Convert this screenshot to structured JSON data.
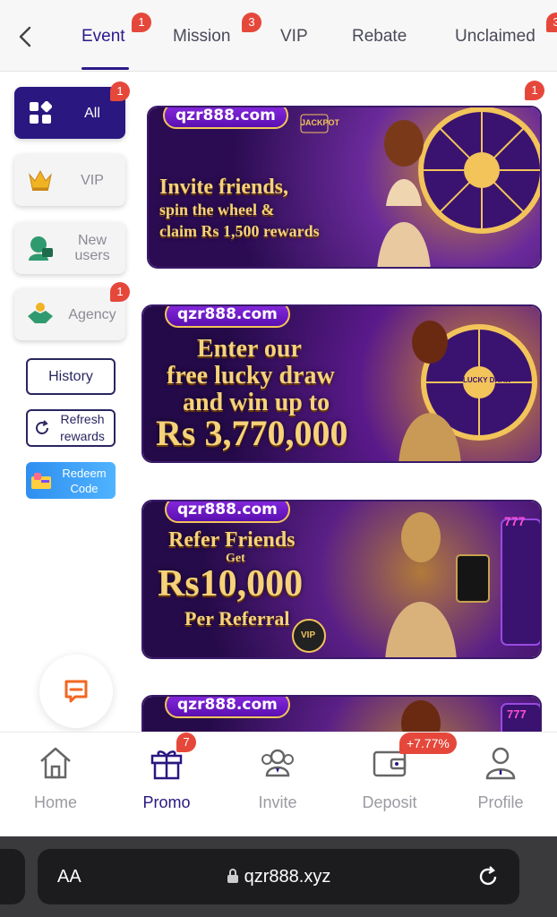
{
  "tabs": [
    {
      "label": "Event",
      "badge": "1"
    },
    {
      "label": "Mission",
      "badge": "3"
    },
    {
      "label": "VIP",
      "badge": ""
    },
    {
      "label": "Rebate",
      "badge": ""
    },
    {
      "label": "Unclaimed",
      "badge": "3"
    }
  ],
  "sidebar": {
    "all_label": "All",
    "all_badge": "1",
    "vip_label": "VIP",
    "new_users_label": "New users",
    "agency_label": "Agency",
    "agency_badge": "1",
    "history_label": "History",
    "refresh_label": "Refresh rewards",
    "redeem_label": "Redeem Code"
  },
  "banners": [
    {
      "domain": "qzr888.com",
      "line1": "Invite friends,",
      "line2": "spin the wheel &",
      "line3": "claim Rs 1,500 rewards",
      "sign": "JACKPOT",
      "badge": "1"
    },
    {
      "domain": "qzr888.com",
      "line1": "Enter our",
      "line2": "free lucky draw",
      "line3": "and win up to",
      "line4": "Rs 3,770,000",
      "wheel": "LUCKY DRAW"
    },
    {
      "domain": "qzr888.com",
      "line1": "Refer Friends",
      "line2": "Get",
      "line3": "Rs10,000",
      "line4": "Per Referral",
      "chip": "VIP",
      "slot": "777"
    },
    {
      "domain": "qzr888.com",
      "slot": "777"
    }
  ],
  "bottom_nav": [
    {
      "label": "Home"
    },
    {
      "label": "Promo",
      "badge": "7"
    },
    {
      "label": "Invite"
    },
    {
      "label": "Deposit",
      "badge": "+7.77%"
    },
    {
      "label": "Profile"
    }
  ],
  "browser": {
    "text_size": "AA",
    "url": "qzr888.xyz"
  },
  "colors": {
    "accent": "#2a1780",
    "badge": "#e5483b",
    "gold": "#f6d27a",
    "banner_purple": "#3a1370"
  }
}
